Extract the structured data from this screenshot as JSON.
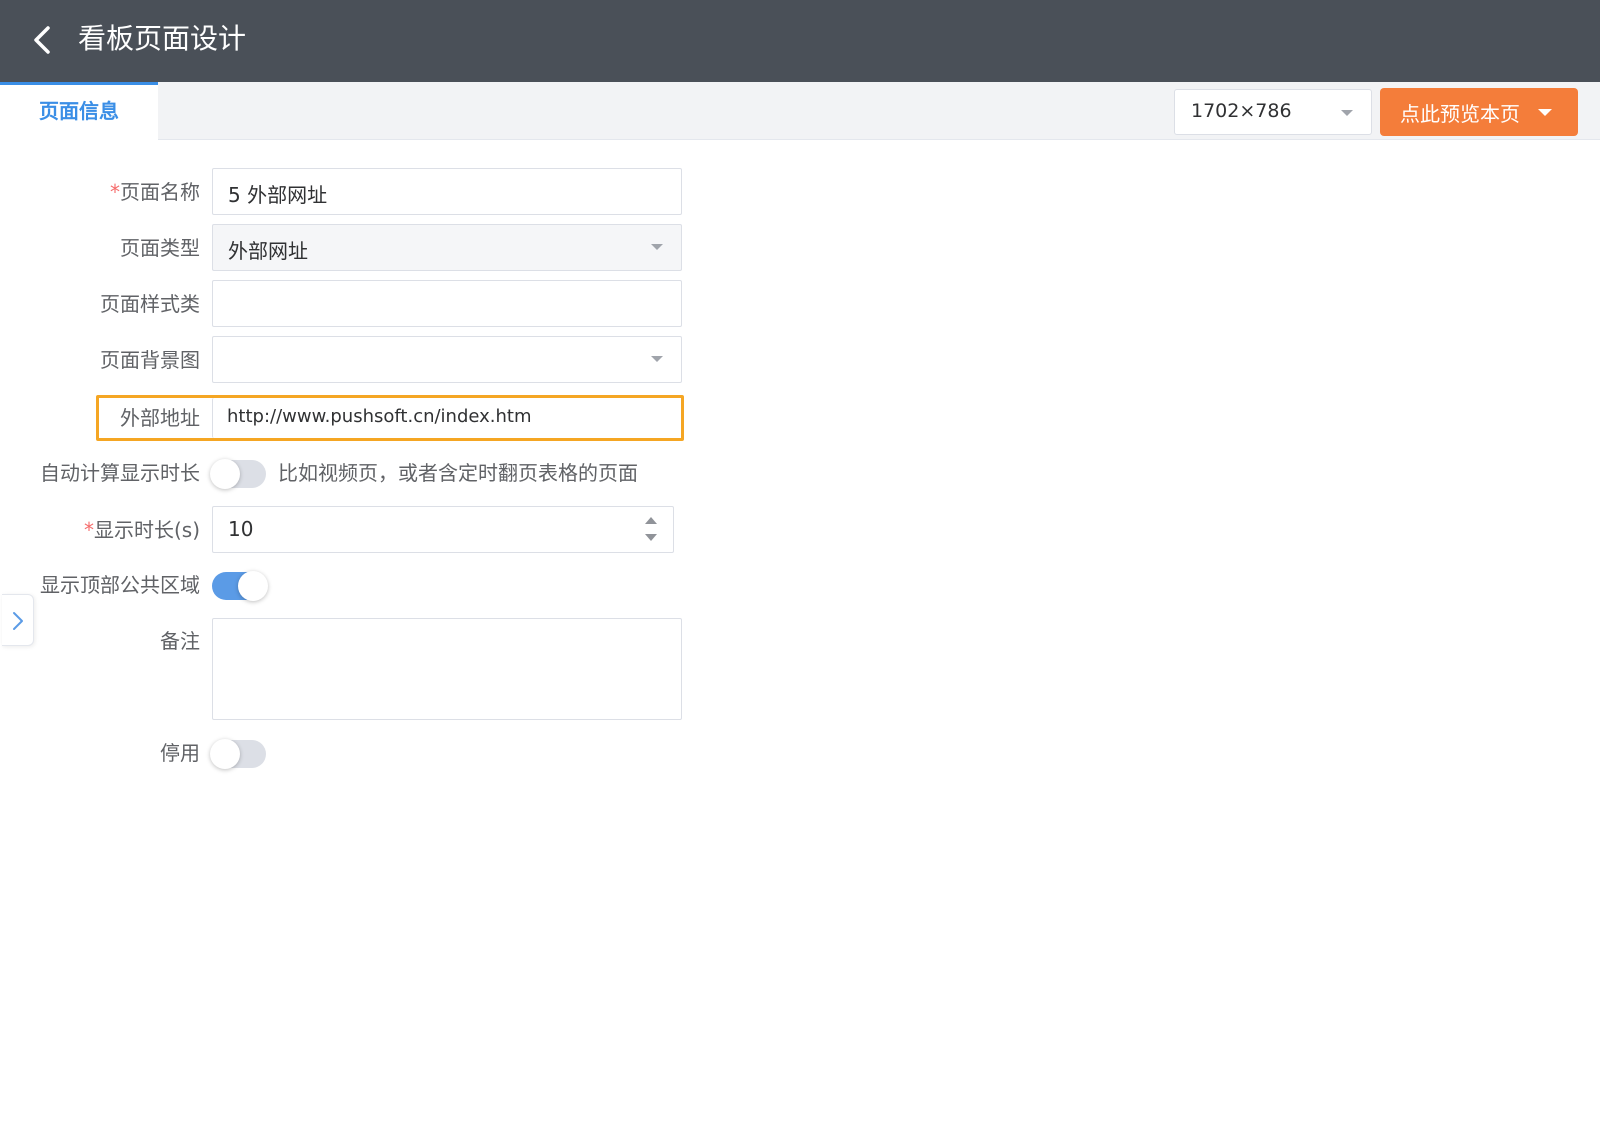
{
  "header": {
    "title": "看板页面设计",
    "back_icon": "chevron-left-icon"
  },
  "tabs": [
    {
      "label": "页面信息",
      "active": true
    }
  ],
  "toolbar": {
    "size_select_value": "1702×786",
    "preview_button_label": "点此预览本页"
  },
  "form": {
    "page_name": {
      "label": "页面名称",
      "required": true,
      "value": "5 外部网址"
    },
    "page_type": {
      "label": "页面类型",
      "value": "外部网址"
    },
    "page_style_class": {
      "label": "页面样式类",
      "value": ""
    },
    "page_background": {
      "label": "页面背景图",
      "value": ""
    },
    "external_url": {
      "label": "外部地址",
      "value": "http://www.pushsoft.cn/index.htm"
    },
    "auto_duration": {
      "label": "自动计算显示时长",
      "enabled": false,
      "hint": "比如视频页，或者含定时翻页表格的页面"
    },
    "display_duration": {
      "label": "显示时长(s)",
      "required": true,
      "value": "10"
    },
    "show_top_area": {
      "label": "显示顶部公共区域",
      "enabled": true
    },
    "remark": {
      "label": "备注",
      "value": ""
    },
    "disabled": {
      "label": "停用",
      "enabled": false
    }
  },
  "colors": {
    "topbar": "#4a5058",
    "accent_blue": "#3a8ee6",
    "preview_orange": "#f47d3a",
    "highlight_border": "#f5a623",
    "required_mark": "#f56c6c"
  }
}
